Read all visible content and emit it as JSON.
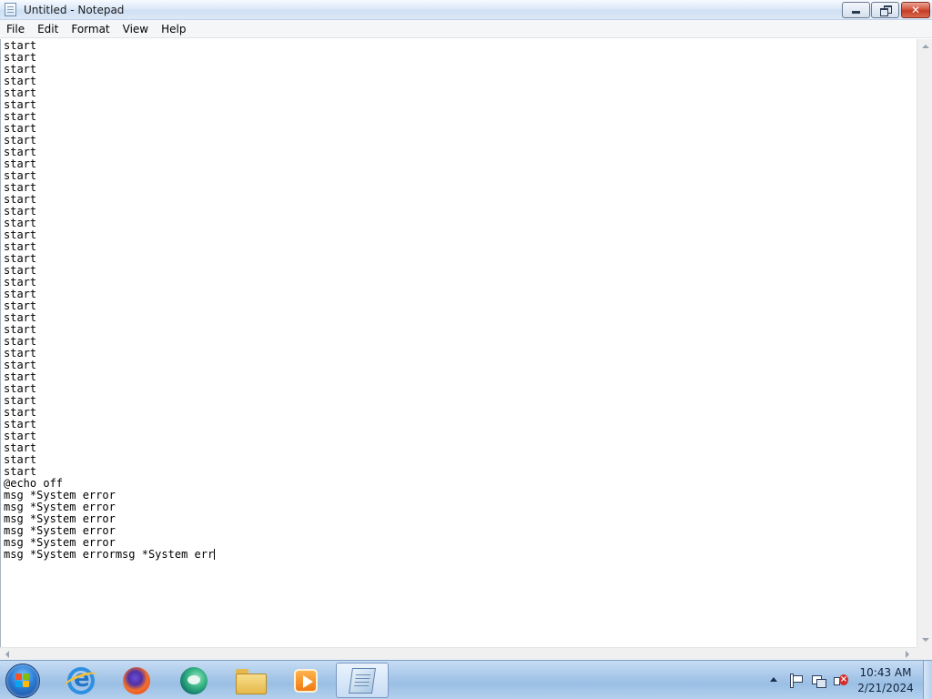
{
  "window": {
    "title": "Untitled - Notepad"
  },
  "menu": {
    "items": [
      {
        "label": "File"
      },
      {
        "label": "Edit"
      },
      {
        "label": "Format"
      },
      {
        "label": "View"
      },
      {
        "label": "Help"
      }
    ]
  },
  "editor": {
    "content": "start\nstart\nstart\nstart\nstart\nstart\nstart\nstart\nstart\nstart\nstart\nstart\nstart\nstart\nstart\nstart\nstart\nstart\nstart\nstart\nstart\nstart\nstart\nstart\nstart\nstart\nstart\nstart\nstart\nstart\nstart\nstart\nstart\nstart\nstart\nstart\nstart\n@echo off\nmsg *System error\nmsg *System error\nmsg *System error\nmsg *System error\nmsg *System error\nmsg *System errormsg *System err"
  },
  "taskbar": {
    "pinned": [
      {
        "name": "internet-explorer-icon"
      },
      {
        "name": "firefox-icon"
      },
      {
        "name": "edge-icon"
      },
      {
        "name": "file-explorer-icon"
      },
      {
        "name": "media-player-icon"
      },
      {
        "name": "notepad-icon",
        "active": true
      }
    ]
  },
  "tray": {
    "time": "10:43 AM",
    "date": "2/21/2024",
    "icons": [
      "action-center-flag-icon",
      "network-icon",
      "volume-muted-icon"
    ]
  },
  "colors": {
    "titlebar": "#dce9f8",
    "taskbar": "#a9c8e9",
    "close_button": "#c23d25"
  }
}
